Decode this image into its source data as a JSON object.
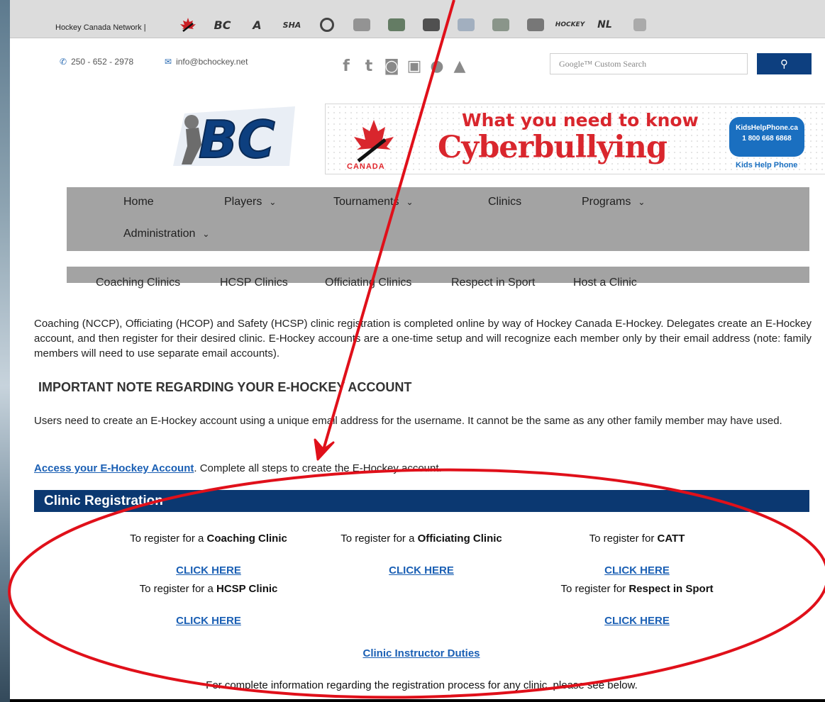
{
  "network_bar": {
    "label": "Hockey Canada Network |",
    "logos": [
      "hockey-canada-logo",
      "bc-hockey-logo",
      "alberta-logo",
      "sha-logo",
      "manitoba-logo",
      "hno-logo",
      "ohf-logo",
      "hockey-quebec-logo",
      "hockey-new-brunswick-logo",
      "hockey-pei-logo",
      "hockey-newfoundland-logo",
      "hockey-nova-scotia-logo",
      "nl-logo",
      "hockey-north-logo"
    ]
  },
  "contact": {
    "phone": "250 - 652 - 2978",
    "email": "info@bchockey.net"
  },
  "social_icons": [
    "facebook-icon",
    "twitter-icon",
    "instagram-icon",
    "youtube-icon",
    "apple-icon",
    "android-icon"
  ],
  "search": {
    "placeholder": "Google™ Custom Search",
    "button_icon": "search-icon"
  },
  "banner": {
    "line1": "What you need to know",
    "line2": "Cyberbullying",
    "canada": "CANADA",
    "khp_site": "KidsHelpPhone.ca",
    "khp_phone": "1 800 668 6868",
    "khp_name": "Kids Help Phone"
  },
  "nav": {
    "home": "Home",
    "players": "Players",
    "tournaments": "Tournaments",
    "clinics": "Clinics",
    "programs": "Programs",
    "administration": "Administration"
  },
  "subnav": {
    "coaching": "Coaching Clinics",
    "hcsp": "HCSP Clinics",
    "officiating": "Officiating Clinics",
    "respect": "Respect in Sport",
    "host": "Host a Clinic"
  },
  "intro": "Coaching (NCCP), Officiating (HCOP) and Safety (HCSP) clinic registration is completed online by way of Hockey Canada E-Hockey. Delegates create an E-Hockey account, and then register for their desired clinic. E-Hockey accounts are a one-time setup and will recognize each member only by their email address (note: family members will need to use separate email accounts).",
  "note_heading": "IMPORTANT NOTE REGARDING YOUR E-HOCKEY ACCOUNT",
  "note_text": "Users need to create an E-Hockey account using a unique email address for the username. It cannot be the same as any other family member may have used.",
  "access": {
    "link": "Access your E-Hockey Account",
    "rest": ". Complete all steps to create the E-Hockey account."
  },
  "registration": {
    "title": "Clinic Registration",
    "prefix_a": "To register for a",
    "prefix_plain": "To register for",
    "coaching": "Coaching Clinic",
    "officiating": "Officiating Clinic",
    "catt": "CATT",
    "hcsp": "HCSP Clinic",
    "respect": "Respect in Sport",
    "click_here": "CLICK HERE",
    "instructor_duties": "Clinic Instructor Duties",
    "footer": "For complete information regarding the registration process for any clinic, please see below."
  },
  "colors": {
    "accent_navy": "#0b3871",
    "link_blue": "#1a5fb4",
    "nav_gray": "#a3a3a3",
    "annotation_red": "#e0101a"
  }
}
